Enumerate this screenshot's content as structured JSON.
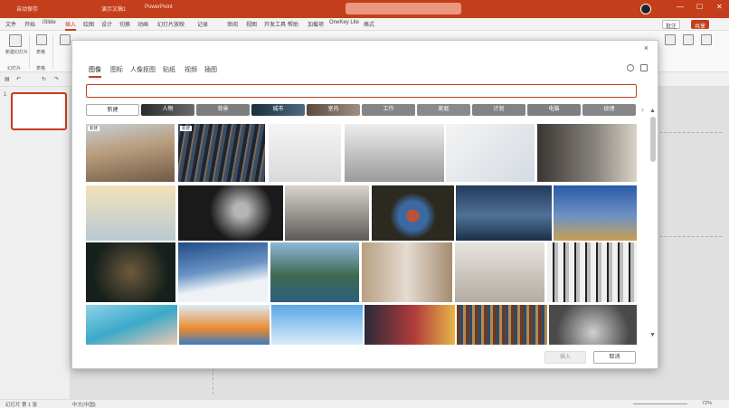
{
  "titlebar": {
    "autosave": "自动保存",
    "file_name": "演示文稿1",
    "app_name": "PowerPoint",
    "search_placeholder": "",
    "minimize": "—",
    "maximize": "☐",
    "close": "✕"
  },
  "ribbon_tabs": [
    "文件",
    "开始",
    "iSlide",
    "插入",
    "绘图",
    "设计",
    "切换",
    "动画",
    "幻灯片放映",
    "记录",
    "审阅",
    "视图",
    "开发工具",
    "帮助",
    "加载项",
    "OneKey Lite",
    "格式"
  ],
  "active_tab": "插入",
  "ribbon_right": {
    "comments": "批注",
    "share": "共享"
  },
  "ribbon": {
    "new_slide": "新建幻灯片",
    "table": "表格",
    "group_slides": "幻灯片",
    "group_table": "表格"
  },
  "dialog": {
    "close": "×",
    "tabs": [
      "图像",
      "图标",
      "人像抠图",
      "贴纸",
      "视频",
      "插图"
    ],
    "active_tab": "图像",
    "search_placeholder": "",
    "chips": [
      "新建",
      "人物",
      "背景",
      "城市",
      "室内",
      "工作",
      "家庭",
      "计划",
      "电脑",
      "纹理"
    ],
    "photo_badges": [
      "新建",
      "新建"
    ],
    "insert_label": "插入",
    "cancel_label": "取消"
  },
  "statusbar": {
    "slide_info": "幻灯片 第 1 张",
    "language": "中文(中国)",
    "zoom": "72%"
  },
  "colors": {
    "accent": "#c43e1c",
    "titlebar": "#c43e1c"
  }
}
